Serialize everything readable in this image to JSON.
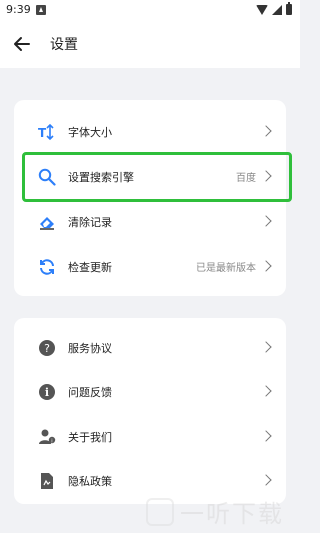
{
  "status": {
    "time": "9:39"
  },
  "header": {
    "title": "设置"
  },
  "card1": [
    {
      "label": "字体大小",
      "value": ""
    },
    {
      "label": "设置搜索引擎",
      "value": "百度"
    },
    {
      "label": "清除记录",
      "value": ""
    },
    {
      "label": "检查更新",
      "value": "已是最新版本"
    }
  ],
  "card2": [
    {
      "label": "服务协议",
      "value": ""
    },
    {
      "label": "问题反馈",
      "value": ""
    },
    {
      "label": "关于我们",
      "value": ""
    },
    {
      "label": "隐私政策",
      "value": ""
    }
  ],
  "colors": {
    "accent_blue": "#2d7ff9",
    "highlight_green": "#2fbf3b",
    "icon_gray": "#555555"
  },
  "watermark": {
    "text": "一听下载"
  }
}
